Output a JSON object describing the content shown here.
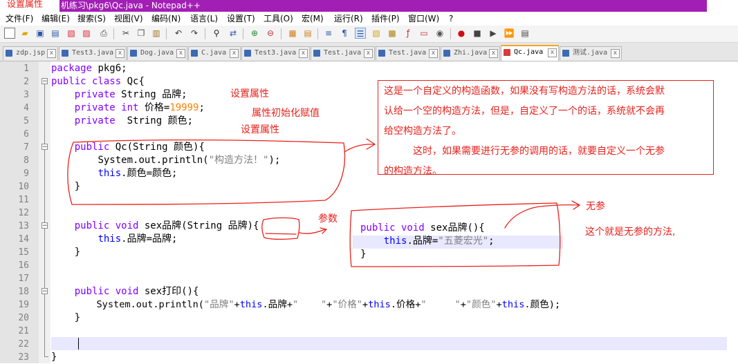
{
  "window": {
    "title_overlay": "设置属性",
    "title": "机练习\\pkg6\\Qc.java - Notepad++"
  },
  "menu": [
    "文件(F)",
    "编辑(E)",
    "搜索(S)",
    "视图(V)",
    "编码(N)",
    "语言(L)",
    "设置(T)",
    "工具(O)",
    "宏(M)",
    "运行(R)",
    "插件(P)",
    "窗口(W)",
    "?"
  ],
  "toolbar": {
    "icons": [
      "new-icon",
      "open-icon",
      "save-icon",
      "save-all-icon",
      "close-icon",
      "close-all-icon",
      "print-icon",
      "cut-icon",
      "copy-icon",
      "paste-icon",
      "undo-icon",
      "redo-icon",
      "find-icon",
      "replace-icon",
      "zoom-in-icon",
      "zoom-out-icon",
      "sync-v-icon",
      "sync-h-icon",
      "word-wrap-icon",
      "show-all-chars-icon",
      "indent-guide-icon",
      "doc-map-icon",
      "function-list-icon",
      "folder-icon",
      "monitor-icon",
      "record-icon",
      "stop-icon",
      "play-icon",
      "play-multi-icon",
      "save-macro-icon"
    ]
  },
  "tabs": [
    {
      "label": "zdp.jsp"
    },
    {
      "label": "Test3.java"
    },
    {
      "label": "Dog.java"
    },
    {
      "label": "C.java"
    },
    {
      "label": "Test3.java"
    },
    {
      "label": "Test.java"
    },
    {
      "label": "Test.java"
    },
    {
      "label": "Zhi.java"
    },
    {
      "label": "Qc.java",
      "active": true
    },
    {
      "label": "测试.java"
    }
  ],
  "line_numbers": [
    "1",
    "2",
    "3",
    "4",
    "5",
    "6",
    "7",
    "8",
    "9",
    "10",
    "11",
    "12",
    "13",
    "14",
    "15",
    "16",
    "17",
    "18",
    "19",
    "20",
    "21",
    "22",
    "23"
  ],
  "code": {
    "l1_kw": "package",
    "l1_rest": " pkg6;",
    "l2_kw1": "public",
    "l2_kw2": " class",
    "l2_rest": " Qc{",
    "l3_kw": "private",
    "l3_rest": " String 品牌;",
    "l4_kw": "private",
    "l4_type": " int",
    "l4_rest": " 价格=",
    "l4_num": "19999",
    "l4_end": ";",
    "l5_kw": "private",
    "l5_rest": "  String 颜色;",
    "l7_kw": "public",
    "l7_rest": " Qc(String 颜色){",
    "l8_rest": "System.out.println(",
    "l8_str": "\"构造方法！\"",
    "l8_end": ");",
    "l9_this": "this",
    "l9_rest": ".颜色=颜色;",
    "l10": "}",
    "l13_kw": "public",
    "l13_type": " void",
    "l13_rest": " sex品牌(String 品牌){",
    "l14_this": "this",
    "l14_rest": ".品牌=品牌;",
    "l15": "}",
    "l18_kw": "public",
    "l18_type": " void",
    "l18_rest": " sex打印(){",
    "l19_a": "System.out.println(",
    "l19_s1": "\"品牌\"",
    "l19_b": "+",
    "l19_t1": "this",
    "l19_c": ".品牌+",
    "l19_s2": "\"    \"",
    "l19_d": "+",
    "l19_s3": "\"价格\"",
    "l19_e": "+",
    "l19_t2": "this",
    "l19_f": ".价格+",
    "l19_s4": "\"     \"",
    "l19_g": "+",
    "l19_s5": "\"颜色\"",
    "l19_h": "+",
    "l19_t3": "this",
    "l19_i": ".颜色);",
    "l20": "}",
    "l23": "}"
  },
  "noparam_snippet": {
    "kw": "public",
    "type": " void",
    "rest": " sex品牌(){",
    "this": "this",
    "body": ".品牌=",
    "str": "\"五菱宏光\"",
    "end": ";",
    "close": "}"
  },
  "annotations": {
    "set_attr_1": "设置属性",
    "init_assign": "属性初始化赋值",
    "set_attr_2": "设置属性",
    "param": "参数",
    "no_param": "无参",
    "no_param_method": "这个就是无参的方法,",
    "constructor_note_1": "这是一个自定义的构造函数，如果没有写构造方法的话，系统会默",
    "constructor_note_2": "认给一个空的构造方法，但是，自定义了一个的话，系统就不会再",
    "constructor_note_3": "给空构造方法了。",
    "constructor_note_4": "　　　这时，如果需要进行无参的调用的话，就要自定义一个无参",
    "constructor_note_5": "的构造方法。"
  },
  "colors": {
    "title_bg": "#a21fb5",
    "annotation": "#e8211b",
    "keyword": "#8000ff",
    "this_keyword": "#0000ff",
    "number": "#ff8000",
    "string": "#808080",
    "active_tab_accent": "#f5a623"
  }
}
